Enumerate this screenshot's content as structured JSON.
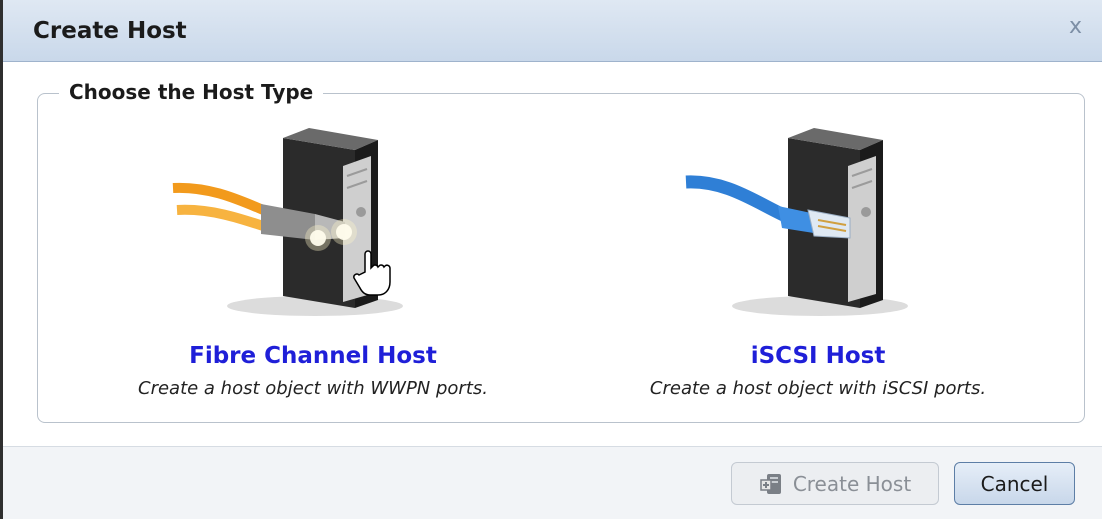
{
  "dialog": {
    "title": "Create Host",
    "close_label": "x"
  },
  "section": {
    "legend": "Choose the Host Type"
  },
  "options": [
    {
      "title": "Fibre Channel Host",
      "description": "Create a host object with WWPN ports."
    },
    {
      "title": "iSCSI Host",
      "description": "Create a host object with iSCSI ports."
    }
  ],
  "footer": {
    "create_label": "Create Host",
    "cancel_label": "Cancel"
  },
  "colors": {
    "title_bar": "#c9d8ea",
    "link": "#1f1fd8",
    "fibre_cable": "#f29a1c",
    "iscsi_cable": "#2f7fd6"
  }
}
